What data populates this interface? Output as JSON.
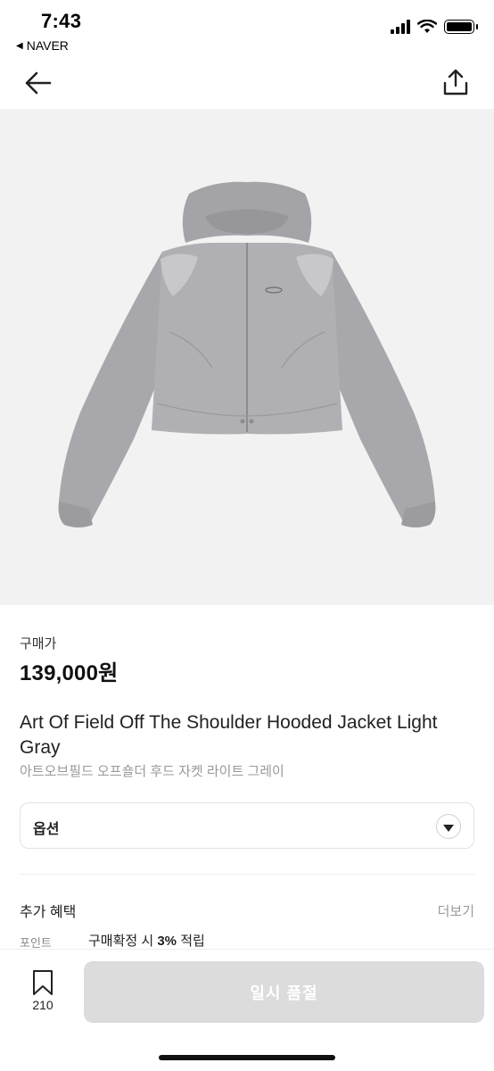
{
  "status_bar": {
    "time": "7:43",
    "back_app": "NAVER",
    "icons": [
      "signal-icon",
      "wifi-icon",
      "battery-icon"
    ]
  },
  "nav": {
    "back_icon": "arrow-left-icon",
    "share_icon": "share-icon"
  },
  "product": {
    "image_alt": "jacket-photo",
    "price_label": "구매가",
    "price": "139,000원",
    "title_en": "Art Of Field Off The Shoulder Hooded Jacket Light Gray",
    "title_ko": "아트오브필드 오프숄더 후드 자켓 라이트 그레이"
  },
  "option": {
    "label": "옵션"
  },
  "benefits": {
    "title": "추가 혜택",
    "more": "더보기",
    "point_label": "포인트",
    "point_text_prefix": "구매확정 시 ",
    "point_text_strong": "3%",
    "point_text_suffix": " 적립"
  },
  "bottom_bar": {
    "wish_count": "210",
    "buy_label": "일시 품절"
  },
  "colors": {
    "background": "#ffffff",
    "image_bg": "#f2f2f2",
    "jacket": "#aeaeb2",
    "disabled_button": "#dcdcdc"
  }
}
